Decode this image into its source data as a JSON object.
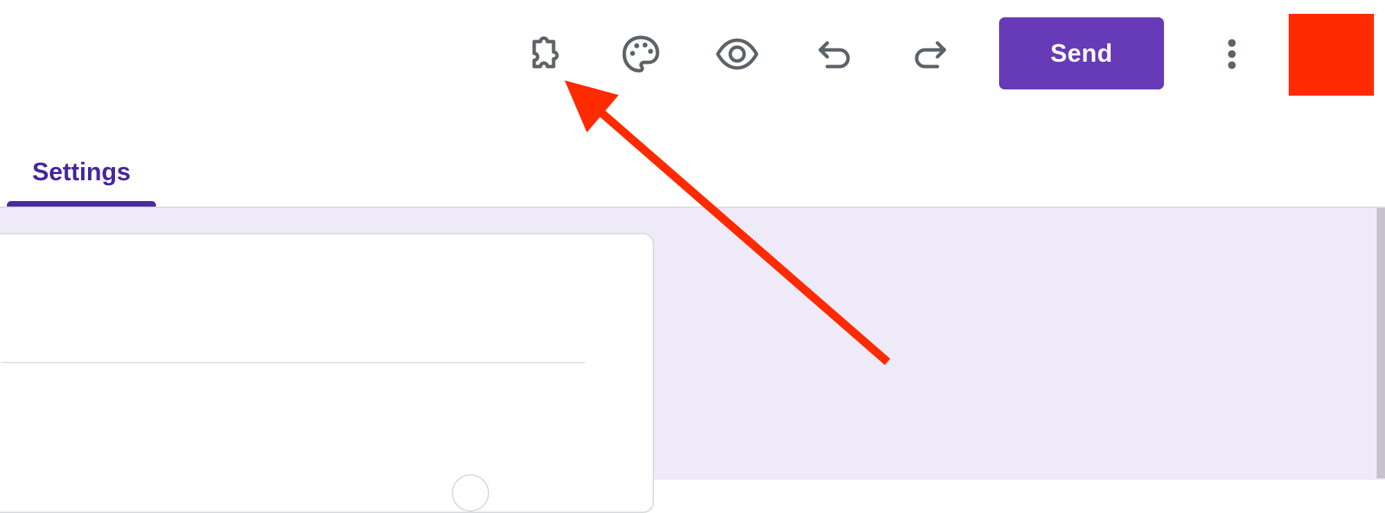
{
  "toolbar": {
    "icons": {
      "addons": "puzzle-icon",
      "customize_theme": "palette-icon",
      "preview": "eye-icon",
      "undo": "undo-icon",
      "redo": "redo-icon",
      "more": "more-vert-icon"
    },
    "send_label": "Send"
  },
  "tabs": {
    "settings_label": "Settings"
  },
  "annotation": {
    "shape": "arrow",
    "color": "#ff2a00",
    "target": "addons"
  },
  "colors": {
    "accent": "#673ab7",
    "tab_text": "#4527a0",
    "icon_gray": "#5f6368",
    "content_bg": "#efeaf7",
    "annotation_red": "#ff2a00"
  }
}
